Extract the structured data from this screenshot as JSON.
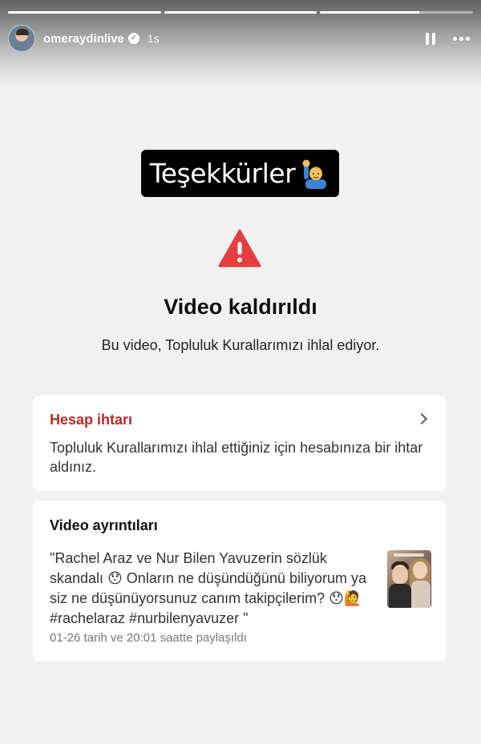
{
  "story": {
    "progress": [
      1.0,
      1.0,
      0.65
    ],
    "username": "omeraydinlive",
    "verified_icon": "✓",
    "time_ago": "1s"
  },
  "sticker": {
    "text": "Teşekkürler",
    "emoji": "raising-hand-icon"
  },
  "notice": {
    "icon": "warning-icon",
    "title": "Video kaldırıldı",
    "subtitle": "Bu video, Topluluk Kurallarımızı ihlal ediyor."
  },
  "strike_card": {
    "title": "Hesap ihtarı",
    "body": "Topluluk Kurallarımızı ihlal ettiğiniz için hesabınıza bir ihtar aldınız."
  },
  "details_card": {
    "title": "Video ayrıntıları",
    "caption": "\"Rachel Araz ve Nur Bilen Yavuzerin sözlük skandalı 😯 Onların ne düşündüğünü biliyorum ya siz ne düşünüyorsunuz canım takipçilerim? 😯🙋 #rachelaraz #nurbilenyavuzer \"",
    "date": "01-26 tarih ve 20:01 saatte paylaşıldı"
  },
  "colors": {
    "warning": "#e53e3e",
    "strike_title": "#b52a2a",
    "background": "#f1f1f1"
  }
}
